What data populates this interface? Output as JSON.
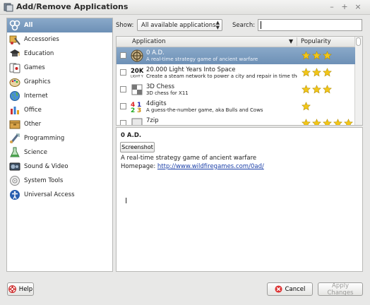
{
  "window": {
    "title": "Add/Remove Applications",
    "controls": [
      "–",
      "+",
      "×"
    ]
  },
  "sidebar": {
    "items": [
      {
        "label": "All",
        "icon": "all-icon",
        "selected": true
      },
      {
        "label": "Accessories",
        "icon": "accessories-icon"
      },
      {
        "label": "Education",
        "icon": "education-icon"
      },
      {
        "label": "Games",
        "icon": "games-icon"
      },
      {
        "label": "Graphics",
        "icon": "graphics-icon"
      },
      {
        "label": "Internet",
        "icon": "internet-icon"
      },
      {
        "label": "Office",
        "icon": "office-icon"
      },
      {
        "label": "Other",
        "icon": "other-icon"
      },
      {
        "label": "Programming",
        "icon": "programming-icon"
      },
      {
        "label": "Science",
        "icon": "science-icon"
      },
      {
        "label": "Sound & Video",
        "icon": "sound-video-icon"
      },
      {
        "label": "System Tools",
        "icon": "system-tools-icon"
      },
      {
        "label": "Universal Access",
        "icon": "universal-access-icon"
      }
    ]
  },
  "filter": {
    "show_label": "Show:",
    "show_value": "All available applications",
    "search_label": "Search:",
    "search_value": ""
  },
  "table": {
    "columns": [
      "Application",
      "Popularity"
    ],
    "rows": [
      {
        "name": "0 A.D.",
        "desc": "A real-time strategy game of ancient warfare",
        "stars": 3,
        "selected": true
      },
      {
        "name": "20.000 Light Years Into Space",
        "desc": "Create a steam network to power a city and repair in time the damage...",
        "stars": 3
      },
      {
        "name": "3D Chess",
        "desc": "3D chess for X11",
        "stars": 3
      },
      {
        "name": "4digits",
        "desc": "A guess-the-number game, aka Bulls and Cows",
        "stars": 1
      },
      {
        "name": "7zip",
        "desc": "",
        "stars": 5
      }
    ]
  },
  "details": {
    "title": "0 A.D.",
    "screenshot_button": "Screenshot",
    "description": "A real-time strategy game of ancient warfare",
    "homepage_label": "Homepage:",
    "homepage_url": "http://www.wildfiregames.com/0ad/"
  },
  "buttons": {
    "help": "Help",
    "cancel": "Cancel",
    "apply": "Apply Changes"
  },
  "colors": {
    "selection": "#7a9ac0",
    "star": "#f2c618",
    "link": "#1a3fa8"
  }
}
